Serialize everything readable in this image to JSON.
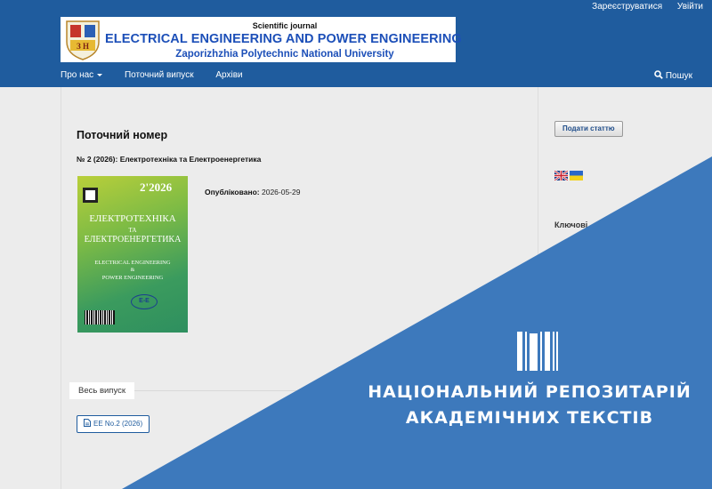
{
  "header": {
    "register_link": "Зареєструватися",
    "login_link": "Увійти",
    "banner": {
      "subtitle": "Scientific journal",
      "title": "ELECTRICAL ENGINEERING AND POWER ENGINEERING",
      "university": "Zaporizhzhia Polytechnic National University"
    }
  },
  "nav": {
    "items": [
      {
        "label": "Про нас"
      },
      {
        "label": "Поточний випуск"
      },
      {
        "label": "Архіви"
      }
    ],
    "search_label": "Пошук"
  },
  "main": {
    "heading": "Поточний номер",
    "issue_title": "№ 2 (2026): Електротехніка та Електроенергетика",
    "cover": {
      "year": "2'2026",
      "title_line1": "ЕЛЕКТРОТЕХНІКА",
      "title_line2": "ТА",
      "title_line3": "ЕЛЕКТРОЕНЕРГЕТИКА",
      "en_line1": "ELECTRICAL ENGINEERING",
      "en_line2": "&",
      "en_line3": "POWER ENGINEERING",
      "logo_text": "Е-Е"
    },
    "published_label": "Опубліковано:",
    "published_date": "2026-05-29",
    "full_issue_label": "Весь випуск",
    "galley_label": "EE No.2 (2026)"
  },
  "sidebar": {
    "submit_button": "Подати статтю",
    "languages": [
      "English",
      "Українська"
    ],
    "keywords_heading": "Ключові"
  },
  "overlay": {
    "line1": "НАЦІОНАЛЬНИЙ РЕПОЗИТАРІЙ",
    "line2": "АКАДЕМІЧНИХ ТЕКСТІВ",
    "color": "#3d79bc"
  },
  "colors": {
    "header_bg": "#1f5c9e",
    "page_bg": "#ececec",
    "banner_text": "#1c4fb8"
  }
}
